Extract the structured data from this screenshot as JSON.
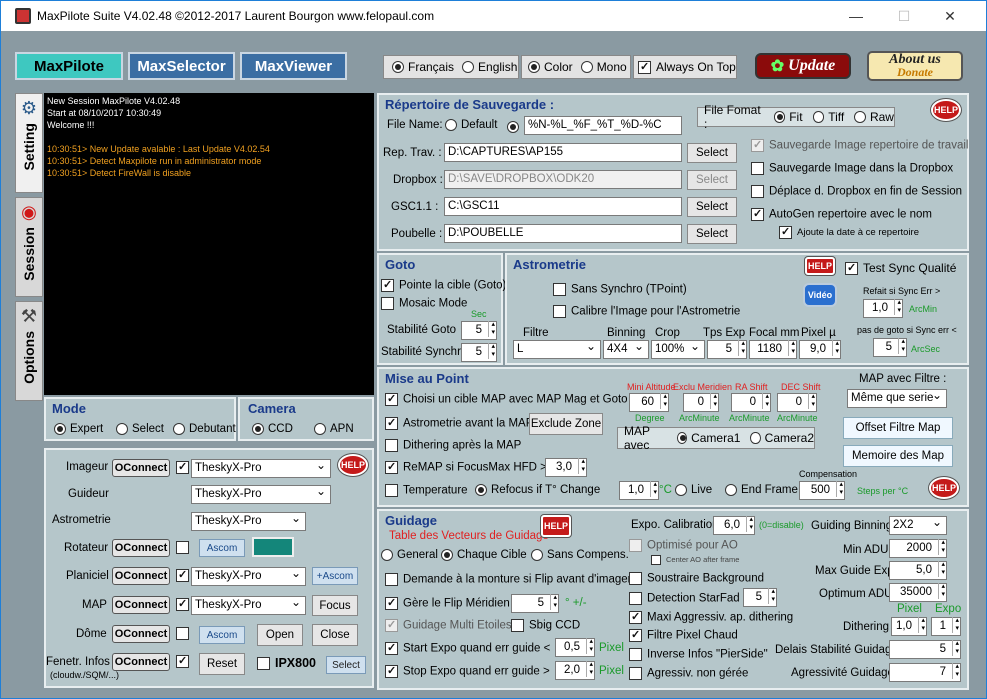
{
  "title": "MaxPilote Suite  V4.02.48  ©2012-2017 Laurent Bourgon  www.felopaul.com",
  "window": {
    "minimize": "—",
    "maximize": "☐",
    "close": "✕"
  },
  "tabs": [
    "MaxPilote",
    "MaxSelector",
    "MaxViewer"
  ],
  "lang": {
    "fr": "Français",
    "en": "English"
  },
  "colormode": {
    "color": "Color",
    "mono": "Mono"
  },
  "always_on_top": "Always On Top",
  "update": "Update",
  "about": {
    "l1": "About us",
    "l2": "Donate"
  },
  "side_tabs": {
    "setting": "Setting",
    "session": "Session",
    "options": "Options"
  },
  "log": [
    "New Session MaxPilote V4.02.48",
    "Start at 08/10/2017 10:30:49",
    "Welcome !!!",
    "",
    "10:30:51> New Update avalable : Last Update V4.02.54",
    "10:30:51> Detect Maxpilote run in administrator mode",
    "10:30:51> Detect FireWall is disable"
  ],
  "mode": {
    "title": "Mode",
    "expert": "Expert",
    "select": "Select",
    "debutant": "Debutant"
  },
  "camera": {
    "title": "Camera",
    "ccd": "CCD",
    "apn": "APN"
  },
  "devices": {
    "imageur": {
      "label": "Imageur",
      "connect": "OConnect",
      "value": "TheskyX-Pro"
    },
    "guideur": {
      "label": "Guideur",
      "value": "TheskyX-Pro"
    },
    "astrometrie": {
      "label": "Astrometrie",
      "value": "TheskyX-Pro"
    },
    "rotateur": {
      "label": "Rotateur",
      "connect": "OConnect",
      "ascom": "Ascom"
    },
    "planiciel": {
      "label": "Planiciel",
      "connect": "OConnect",
      "value": "TheskyX-Pro",
      "ascom": "+Ascom"
    },
    "map": {
      "label": "MAP",
      "connect": "OConnect",
      "value": "TheskyX-Pro",
      "focus": "Focus"
    },
    "dome": {
      "label": "Dôme",
      "connect": "OConnect",
      "ascom": "Ascom",
      "open": "Open",
      "close": "Close"
    },
    "fenetr": {
      "label": "Fenetr. Infos",
      "sub": "(cloudw./SQM/...)",
      "connect": "OConnect",
      "reset": "Reset",
      "ipx": "IPX800",
      "select": "Select"
    }
  },
  "help": "HELP",
  "repertoire": {
    "title": "Répertoire de Sauvegarde :",
    "file_name": "File Name:",
    "default": "Default",
    "pattern": "%N-%L_%F_%T_%D-%C",
    "file_format": "File Fomat :",
    "fit": "Fit",
    "tiff": "Tiff",
    "raw": "Raw",
    "rep_trav_label": "Rep. Trav. :",
    "rep_trav": "D:\\CAPTURES\\AP155",
    "dropbox_label": "Dropbox :",
    "dropbox": "D:\\SAVE\\DROPBOX\\ODK20",
    "gsc_label": "GSC1.1 :",
    "gsc": "C:\\GSC11",
    "poubelle_label": "Poubelle :",
    "poubelle": "D:\\POUBELLE",
    "select": "Select",
    "c1": "Sauvegarde Image repertoire de travail",
    "c2": "Sauvegarde Image dans la Dropbox",
    "c3": "Déplace d. Dropbox  en fin de Session",
    "c4": "AutoGen repertoire avec le nom",
    "c5": "Ajoute la date à ce repertoire"
  },
  "goto": {
    "title": "Goto",
    "pointe": "Pointe la cible (Goto)",
    "mosaic": "Mosaic Mode",
    "sec": "Sec",
    "stab_goto": "Stabilité Goto",
    "stab_goto_v": "5",
    "stab_sync": "Stabilité Synchro",
    "stab_sync_v": "5"
  },
  "astrometrie": {
    "title": "Astrometrie",
    "sans_synchro": "Sans Synchro (TPoint)",
    "calibre": "Calibre l'Image pour l'Astrometrie",
    "video": "Vidéo",
    "test_sync": "Test Sync Qualité",
    "refait": "Refait si Sync Err >",
    "refait_v": "1,0",
    "arcmin": "ArcMin",
    "pas_goto": "pas de goto si Sync err <",
    "pas_goto_v": "5",
    "arcsec": "ArcSec",
    "filtre_h": "Filtre",
    "binning_h": "Binning",
    "crop_h": "Crop",
    "tpsexp_h": "Tps Exp",
    "focal_h": "Focal mm",
    "pixel_h": "Pixel µ",
    "filtre": "L",
    "binning": "4X4",
    "crop": "100%",
    "tpsexp": "5",
    "focal": "1180",
    "pixel": "9,0"
  },
  "map": {
    "title": "Mise au Point",
    "m1": "Choisi un cible MAP  avec MAP Mag et Goto",
    "m2": "Astrometrie avant la MAP",
    "exclude": "Exclude Zone",
    "m3": "Dithering après la MAP",
    "m4": "ReMAP si FocusMax HFD >",
    "m4v": "3,0",
    "m5": "Temperature",
    "refocus": "Refocus if  T°  Change",
    "refocus_v": "1,0",
    "deg_c": "°C",
    "live": "Live",
    "endframe": "End Frame",
    "comp_label": "Compensation",
    "comp_v": "500",
    "steps": "Steps per °C",
    "minalt_h": "Mini Altitude",
    "minalt": "60",
    "degree": "Degree",
    "excl_h": "Exclu Meridien",
    "excl": "0",
    "ra_h": "RA Shift",
    "ra": "0",
    "dec_h": "DEC Shift",
    "dec": "0",
    "arcminute": "ArcMinute",
    "map_avec": "MAP avec",
    "cam1": "Camera1",
    "cam2": "Camera2",
    "map_filtre": "MAP avec Filtre :",
    "meme": "Même que serie",
    "offset": "Offset Filtre Map",
    "memoire": "Memoire des Map"
  },
  "guidage": {
    "title": "Guidage",
    "table": "Table des Vecteurs de Guidage",
    "general": "General",
    "chaque": "Chaque Cible",
    "sans_comp": "Sans Compens.",
    "g1": "Demande à la monture si Flip avant d'imager",
    "g2": "Gère le Flip Méridien",
    "g2v": "5",
    "g2u": "° +/-",
    "g3": "Guidage Multi Etoiles",
    "g3b": "Sbig CCD",
    "g4": "Start Expo quand err guide <",
    "g4v": "0,5",
    "g5": "Stop Expo quand  err guide >",
    "g5v": "2,0",
    "pixel": "Pixel",
    "expo_cal": "Expo. Calibration",
    "expo_cal_v": "6,0",
    "expo_cal_u": "(0=disable)",
    "optimise": "Optimisé pour  AO",
    "center_ao": "Center AO after frame",
    "soustraire": "Soustraire Background",
    "detection": "Detection  StarFad",
    "detection_v": "5",
    "maxi": "Maxi Aggressiv. ap. dithering",
    "filtre_pixel": "Filtre Pixel Chaud",
    "inverse": "Inverse Infos \"PierSide\"",
    "agressiv": "Agressiv.  non gérée",
    "binning_label": "Guiding Binning",
    "binning": "2X2",
    "min_adu": "Min ADU",
    "min_adu_v": "2000",
    "max_guide": "Max Guide Exp",
    "max_guide_v": "5,0",
    "optimum": "Optimum ADU",
    "optimum_v": "35000",
    "pixel_h": "Pixel",
    "expo_h": "Expo",
    "dithering": "Dithering",
    "dith_pixel": "1,0",
    "dith_expo": "1",
    "delais": "Delais Stabilité Guidage",
    "delais_v": "5",
    "agressivite": "Agressivité Guidage",
    "agressivite_v": "7"
  }
}
